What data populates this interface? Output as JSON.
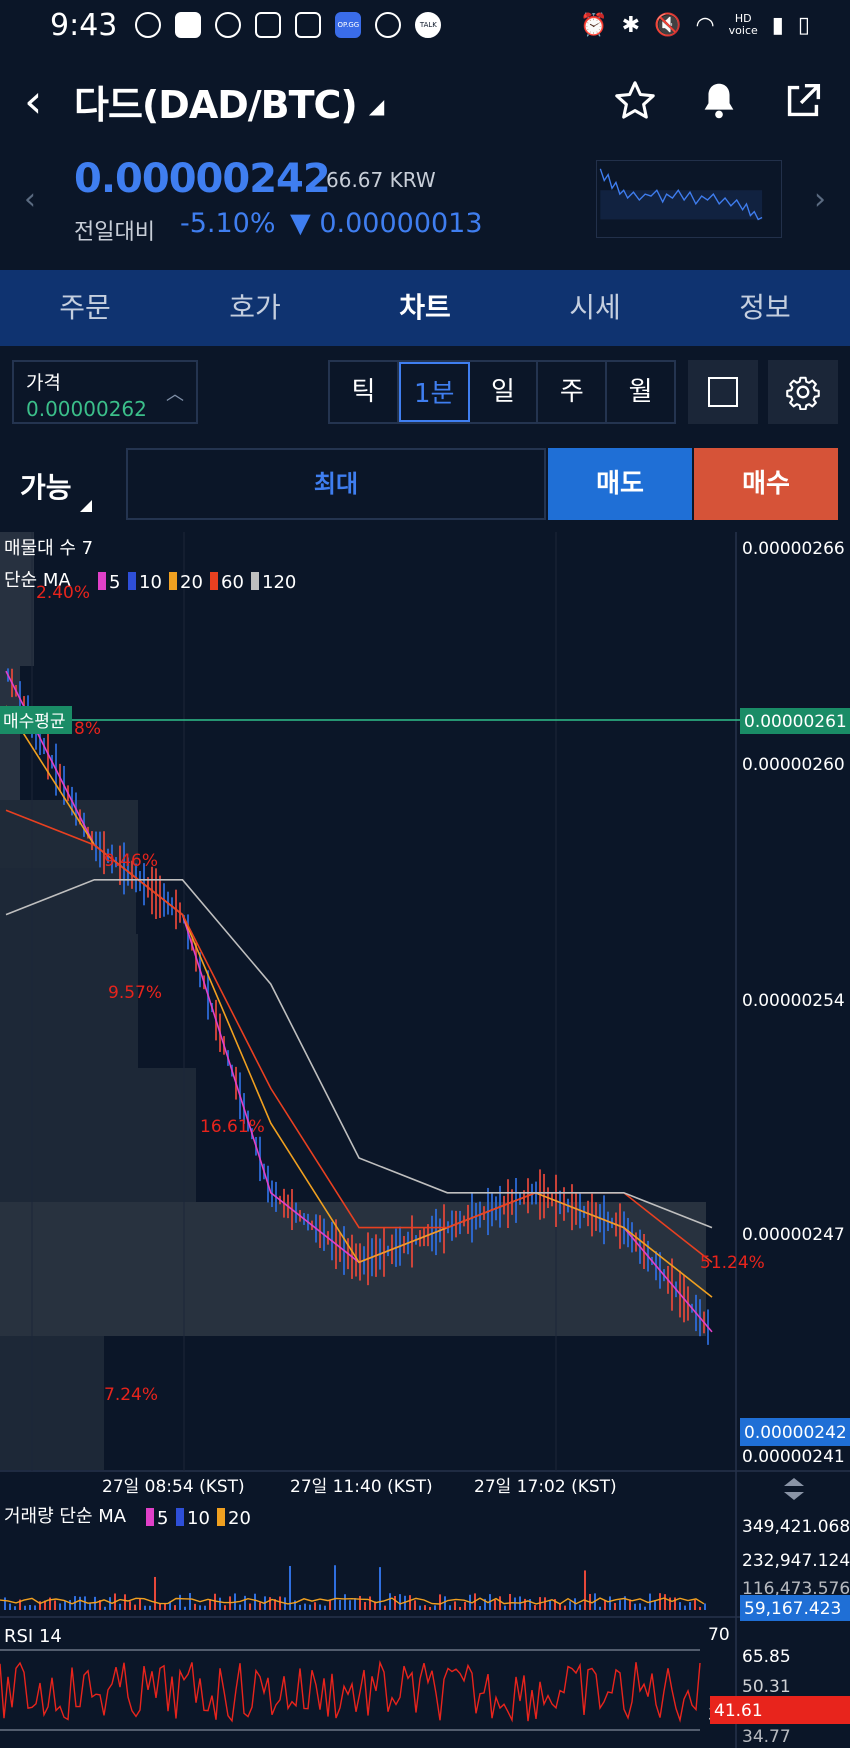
{
  "status_bar": {
    "time": "9:43",
    "app_icons": [
      "threads-icon",
      "youtube-icon",
      "tiktok-icon",
      "instagram-icon",
      "instagram-icon",
      "opgg-icon",
      "flower-icon",
      "kakaotalk-icon"
    ],
    "talk_label": "TALK",
    "opgg_label": "OP.GG",
    "hd_label": "HD",
    "voice_label": "voice"
  },
  "header": {
    "title": "다드(DAD/BTC)",
    "back_icon": "chevron-left-icon",
    "icons": [
      "star-icon",
      "bell-icon",
      "share-icon"
    ]
  },
  "ticker": {
    "price": "0.00000242",
    "krw": "66.67 KRW",
    "change_label": "전일대비",
    "change_pct": "-5.10%",
    "change_abs": "▼ 0.00000013",
    "accent": "#3f7ef0"
  },
  "tabs": [
    {
      "label": "주문",
      "active": false
    },
    {
      "label": "호가",
      "active": false
    },
    {
      "label": "차트",
      "active": true
    },
    {
      "label": "시세",
      "active": false
    },
    {
      "label": "정보",
      "active": false
    }
  ],
  "controls": {
    "price_label": "가격",
    "price_value": "0.00000262",
    "periods": [
      "틱",
      "1분",
      "일",
      "주",
      "월"
    ],
    "active_period": "1분",
    "available_label": "가능",
    "max_label": "최대",
    "sell_label": "매도",
    "buy_label": "매수",
    "sell_color": "#1f6fd6",
    "buy_color": "#d65338"
  },
  "chart": {
    "volume_profile_label": "매물대 수 7",
    "ma_label": "단순 MA",
    "ma_periods": [
      "5",
      "10",
      "20",
      "60",
      "120"
    ],
    "ma_colors": [
      "#e040c8",
      "#2e4fd8",
      "#f0a020",
      "#e84020",
      "#bfbfbf"
    ],
    "avg_buy_label": "매수평균",
    "avg_buy_price": "0.00000261",
    "current_price": "0.00000242",
    "price_axis": [
      "0.00000266",
      "0.00000260",
      "0.00000254",
      "0.00000247",
      "0.00000241"
    ],
    "profile_pcts": [
      "2.40%",
      "8%",
      "9.46%",
      "9.57%",
      "16.61%",
      "51.24%",
      "7.24%"
    ],
    "time_axis": [
      "27일 08:54 (KST)",
      "27일 11:40 (KST)",
      "27일 17:02 (KST)"
    ],
    "volume_label": "거래량 단순 MA",
    "volume_ma_periods": [
      "5",
      "10",
      "20"
    ],
    "volume_axis": [
      "349,421.068",
      "232,947.124",
      "116,473.576"
    ],
    "volume_current": "59,167.423",
    "rsi_label": "RSI 14",
    "rsi_levels": [
      "70",
      "30"
    ],
    "rsi_axis": [
      "65.85",
      "50.31",
      "34.77"
    ],
    "rsi_current": "41.61"
  },
  "chart_data": {
    "type": "line",
    "title": "다드(DAD/BTC) 1분",
    "x": [
      "27일 08:54 (KST)",
      "27일 11:40 (KST)",
      "27일 17:02 (KST)"
    ],
    "series": [
      {
        "name": "5",
        "values": [
          2.63e-06,
          2.58e-06,
          2.56e-06,
          2.48e-06,
          2.46e-06,
          2.47e-06,
          2.48e-06,
          2.47e-06,
          2.44e-06
        ]
      },
      {
        "name": "20",
        "values": [
          2.62e-06,
          2.58e-06,
          2.56e-06,
          2.5e-06,
          2.46e-06,
          2.47e-06,
          2.48e-06,
          2.47e-06,
          2.45e-06
        ]
      },
      {
        "name": "60",
        "values": [
          2.59e-06,
          2.58e-06,
          2.56e-06,
          2.51e-06,
          2.47e-06,
          2.47e-06,
          2.48e-06,
          2.48e-06,
          2.46e-06
        ]
      },
      {
        "name": "120",
        "values": [
          2.56e-06,
          2.57e-06,
          2.57e-06,
          2.54e-06,
          2.49e-06,
          2.48e-06,
          2.48e-06,
          2.48e-06,
          2.47e-06
        ]
      }
    ],
    "ylim": [
      2.4e-06,
      2.67e-06
    ],
    "grid": false
  }
}
